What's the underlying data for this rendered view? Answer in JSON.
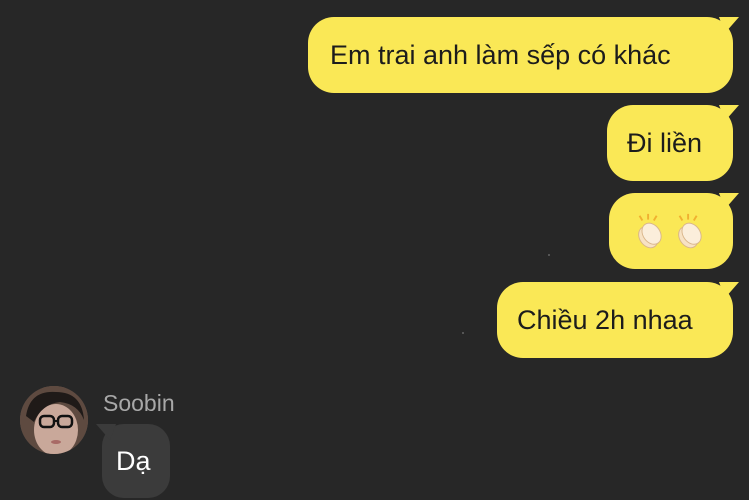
{
  "chat": {
    "outgoing_messages": [
      {
        "text": "Em trai anh làm sếp có khác"
      },
      {
        "text": "Đi liền"
      },
      {
        "emojis": [
          "clapping-hands",
          "clapping-hands"
        ]
      },
      {
        "text": "Chiều 2h nhaa"
      }
    ],
    "incoming": {
      "sender_name": "Soobin",
      "message": "Dạ"
    }
  },
  "colors": {
    "background": "#272727",
    "outgoing_bubble": "#fae856",
    "incoming_bubble": "#3b3b3b",
    "sender_name": "#a8a8a8"
  }
}
